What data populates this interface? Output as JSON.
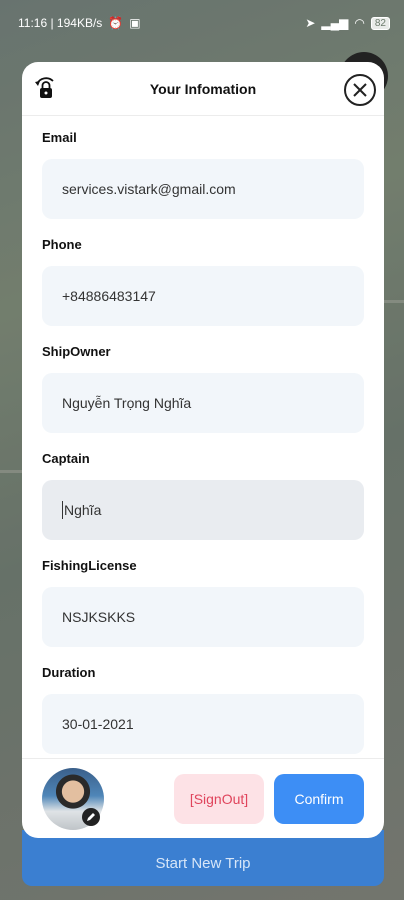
{
  "status_bar": {
    "time_speed": "11:16 | 194KB/s",
    "battery": "82"
  },
  "modal": {
    "title": "Your Infomation",
    "lock_icon": "lock-refresh-icon",
    "close_icon": "close-icon"
  },
  "form": {
    "fields": [
      {
        "label": "Email",
        "value": "services.vistark@gmail.com"
      },
      {
        "label": "Phone",
        "value": "+84886483147"
      },
      {
        "label": "ShipOwner",
        "value": "Nguyễn Trọng Nghĩa"
      },
      {
        "label": "Captain",
        "value": "Nghĩa"
      },
      {
        "label": "FishingLicense",
        "value": "NSJKSKKS"
      },
      {
        "label": "Duration",
        "value": "30-01-2021"
      }
    ]
  },
  "footer": {
    "signout_label": "[SignOut]",
    "confirm_label": "Confirm"
  },
  "background": {
    "start_trip_label": "Start New Trip"
  },
  "colors": {
    "primary": "#3d8ef5",
    "signout_bg": "#fde2e6",
    "signout_text": "#e0445c",
    "input_bg": "#f2f6fa"
  }
}
